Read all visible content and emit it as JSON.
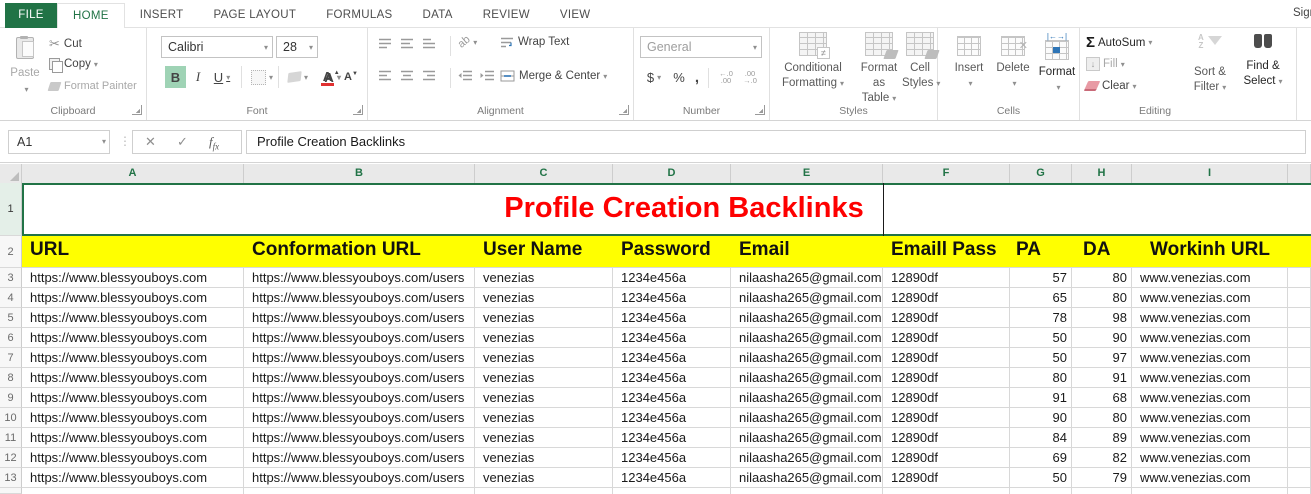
{
  "window": {
    "sign_in": "Sign in"
  },
  "tabs": {
    "file": "FILE",
    "items": [
      {
        "label": "HOME",
        "active": true
      },
      {
        "label": "INSERT"
      },
      {
        "label": "PAGE LAYOUT"
      },
      {
        "label": "FORMULAS"
      },
      {
        "label": "DATA"
      },
      {
        "label": "REVIEW"
      },
      {
        "label": "VIEW"
      }
    ]
  },
  "ribbon": {
    "clipboard": {
      "group": "Clipboard",
      "paste": "Paste",
      "cut": "Cut",
      "copy": "Copy",
      "format_painter": "Format Painter"
    },
    "font": {
      "group": "Font",
      "family": "Calibri",
      "size": "28",
      "bold": "B",
      "italic": "I",
      "underline": "U",
      "grow": "A",
      "shrink": "A",
      "color_a": "A"
    },
    "alignment": {
      "group": "Alignment",
      "wrap": "Wrap Text",
      "merge": "Merge & Center"
    },
    "number": {
      "group": "Number",
      "format": "General",
      "currency": "$",
      "percent": "%",
      "comma": ",",
      "inc_top": "←.0",
      "inc_bot": ".00",
      "dec_top": ".00",
      "dec_bot": "→.0"
    },
    "styles": {
      "group": "Styles",
      "cond1": "Conditional",
      "cond2": "Formatting",
      "fat1": "Format as",
      "fat2": "Table",
      "cs1": "Cell",
      "cs2": "Styles"
    },
    "cells": {
      "group": "Cells",
      "insert": "Insert",
      "delete": "Delete",
      "format": "Format"
    },
    "editing": {
      "group": "Editing",
      "autosum": "AutoSum",
      "fill": "Fill",
      "clear": "Clear",
      "sf1": "Sort &",
      "sf2": "Filter",
      "fs1": "Find &",
      "fs2": "Select"
    }
  },
  "formula_bar": {
    "name_box": "A1",
    "fx": "fx",
    "formula": "Profile Creation Backlinks"
  },
  "sheet": {
    "title": "Profile Creation Backlinks",
    "col_letters": [
      "A",
      "B",
      "C",
      "D",
      "E",
      "F",
      "G",
      "H",
      "I",
      ""
    ],
    "row_numbers": [
      "1",
      "2",
      "3",
      "4",
      "5",
      "6",
      "7",
      "8",
      "9",
      "10",
      "11",
      "12",
      "13",
      ""
    ],
    "headers": [
      "URL",
      "Conformation URL",
      "User Name",
      "Password",
      "Email",
      "Emaill Pass",
      "PA",
      "DA",
      "Workinh URL"
    ],
    "rows": [
      [
        "https://www.blessyouboys.com",
        "https://www.blessyouboys.com/users",
        "venezias",
        "1234e456a",
        "nilaasha265@gmail.com",
        "12890df",
        "57",
        "80",
        "www.venezias.com"
      ],
      [
        "https://www.blessyouboys.com",
        "https://www.blessyouboys.com/users",
        "venezias",
        "1234e456a",
        "nilaasha265@gmail.com",
        "12890df",
        "65",
        "80",
        "www.venezias.com"
      ],
      [
        "https://www.blessyouboys.com",
        "https://www.blessyouboys.com/users",
        "venezias",
        "1234e456a",
        "nilaasha265@gmail.com",
        "12890df",
        "78",
        "98",
        "www.venezias.com"
      ],
      [
        "https://www.blessyouboys.com",
        "https://www.blessyouboys.com/users",
        "venezias",
        "1234e456a",
        "nilaasha265@gmail.com",
        "12890df",
        "50",
        "90",
        "www.venezias.com"
      ],
      [
        "https://www.blessyouboys.com",
        "https://www.blessyouboys.com/users",
        "venezias",
        "1234e456a",
        "nilaasha265@gmail.com",
        "12890df",
        "50",
        "97",
        "www.venezias.com"
      ],
      [
        "https://www.blessyouboys.com",
        "https://www.blessyouboys.com/users",
        "venezias",
        "1234e456a",
        "nilaasha265@gmail.com",
        "12890df",
        "80",
        "91",
        "www.venezias.com"
      ],
      [
        "https://www.blessyouboys.com",
        "https://www.blessyouboys.com/users",
        "venezias",
        "1234e456a",
        "nilaasha265@gmail.com",
        "12890df",
        "91",
        "68",
        "www.venezias.com"
      ],
      [
        "https://www.blessyouboys.com",
        "https://www.blessyouboys.com/users",
        "venezias",
        "1234e456a",
        "nilaasha265@gmail.com",
        "12890df",
        "90",
        "80",
        "www.venezias.com"
      ],
      [
        "https://www.blessyouboys.com",
        "https://www.blessyouboys.com/users",
        "venezias",
        "1234e456a",
        "nilaasha265@gmail.com",
        "12890df",
        "84",
        "89",
        "www.venezias.com"
      ],
      [
        "https://www.blessyouboys.com",
        "https://www.blessyouboys.com/users",
        "venezias",
        "1234e456a",
        "nilaasha265@gmail.com",
        "12890df",
        "69",
        "82",
        "www.venezias.com"
      ],
      [
        "https://www.blessyouboys.com",
        "https://www.blessyouboys.com/users",
        "venezias",
        "1234e456a",
        "nilaasha265@gmail.com",
        "12890df",
        "50",
        "79",
        "www.venezias.com"
      ]
    ]
  },
  "colors": {
    "excel_green": "#217346",
    "header_yellow": "#ffff00",
    "title_red": "#fe0000"
  }
}
